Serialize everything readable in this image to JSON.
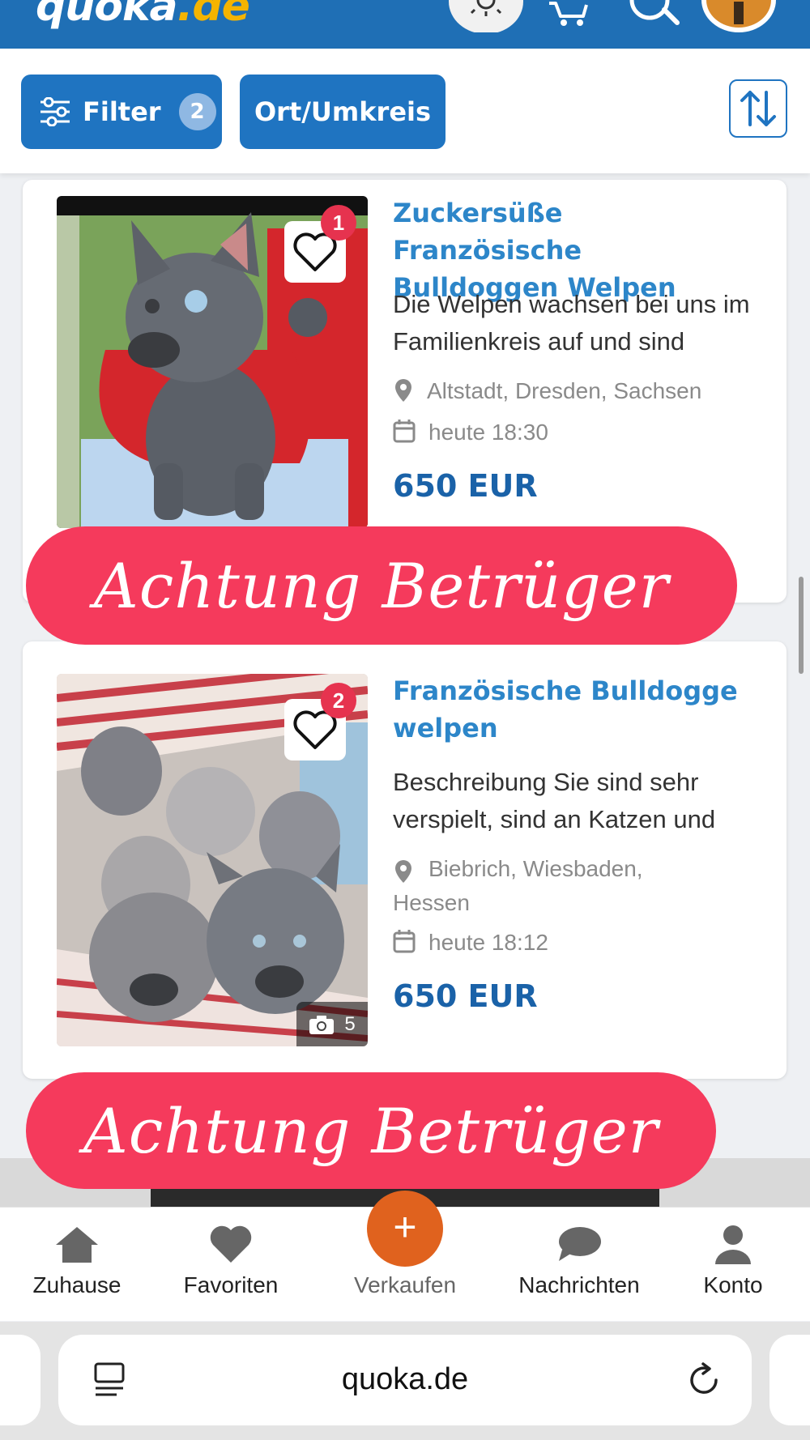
{
  "header": {
    "logo_text": "quoka",
    "logo_tld": ".de"
  },
  "filterbar": {
    "filter_label": "Filter",
    "filter_count": "2",
    "location_label": "Ort/Umkreis"
  },
  "listings": [
    {
      "favorite_count": "1",
      "title": "Zuckersüße Französische Bulldoggen Welpen",
      "description": "Die Welpen wachsen bei uns im Familienkreis auf und sind",
      "location": "Altstadt, Dresden, Sachsen",
      "date": "heute 18:30",
      "price": "650 EUR"
    },
    {
      "favorite_count": "2",
      "title": "Französische Bulldogge welpen",
      "description": "Beschreibung Sie sind sehr verspielt, sind an Katzen und",
      "location": "Biebrich, Wiesbaden, Hessen",
      "date": "heute 18:12",
      "price": "650 EUR",
      "photo_count": "5"
    }
  ],
  "warnings": [
    "Achtung Betrüger",
    "Achtung Betrüger"
  ],
  "bottomnav": {
    "home": "Zuhause",
    "favorites": "Favoriten",
    "sell": "Verkaufen",
    "sell_symbol": "+",
    "messages": "Nachrichten",
    "account": "Konto"
  },
  "browser": {
    "url": "quoka.de"
  },
  "colors": {
    "brand_blue": "#1f6fb5",
    "warning_red": "#f53a5c",
    "sell_orange": "#e0621e",
    "title_blue": "#2d86c9",
    "price_blue": "#1a62a8"
  }
}
